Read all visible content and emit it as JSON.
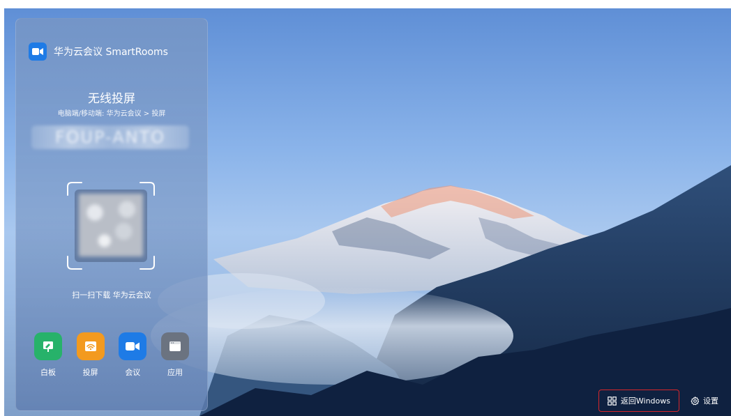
{
  "brand": {
    "name": "华为云会议 SmartRooms",
    "icon": "video-camera-icon",
    "color": "#1e7be6"
  },
  "projection": {
    "title": "无线投屏",
    "instructions": "电脑端/移动端: 华为云会议 > 投屏",
    "device_code": "FOUP-ANTO"
  },
  "qr": {
    "caption": "扫一扫下载 华为云会议"
  },
  "apps": [
    {
      "label": "白板",
      "icon": "whiteboard-icon",
      "color": "#27b26a"
    },
    {
      "label": "投屏",
      "icon": "wireless-projection-icon",
      "color": "#f39a1f"
    },
    {
      "label": "会议",
      "icon": "video-camera-icon",
      "color": "#1e7be6"
    },
    {
      "label": "应用",
      "icon": "apps-window-icon",
      "color": "#6b7380"
    }
  ],
  "bottom_bar": {
    "return_windows": {
      "label": "返回Windows",
      "icon": "windows-grid-icon"
    },
    "settings": {
      "label": "设置",
      "icon": "gear-icon"
    }
  }
}
